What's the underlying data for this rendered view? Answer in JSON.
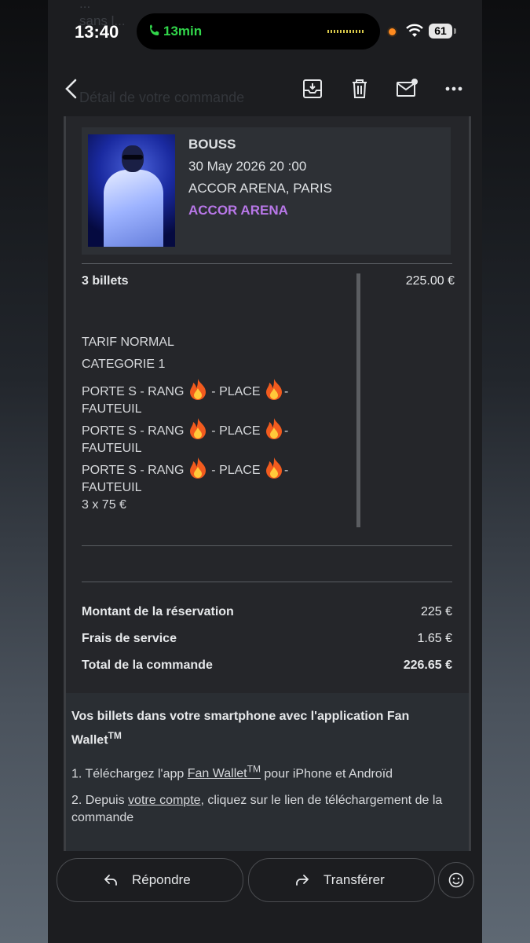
{
  "status_bar": {
    "time": "13:40",
    "call_duration": "13min",
    "battery": "61"
  },
  "background_ghost": {
    "line1": "...",
    "line2": "sans l...",
    "heading": "Détail de votre commande"
  },
  "event": {
    "artist": "BOUSS",
    "date": "30 May 2026 20 :00",
    "venue": "ACCOR ARENA, PARIS",
    "venue_link": "ACCOR ARENA"
  },
  "tickets": {
    "count_label": "3 billets",
    "price": "225.00 €",
    "tariff": "TARIF NORMAL",
    "category": "CATEGORIE 1",
    "seats": [
      {
        "a": "PORTE S - RANG ",
        "b": " - PLACE ",
        "c": "- FAUTEUIL"
      },
      {
        "a": "PORTE S - RANG ",
        "b": " - PLACE ",
        "c": "- FAUTEUIL"
      },
      {
        "a": "PORTE S - RANG ",
        "b": " - PLACE ",
        "c": "- FAUTEUIL"
      }
    ],
    "unit_price": "3 x 75 €"
  },
  "summary": {
    "reservation_label": "Montant de la réservation",
    "reservation_value": "225 €",
    "fees_label": "Frais de service",
    "fees_value": "1.65 €",
    "total_label": "Total de la commande",
    "total_value": "226.65 €"
  },
  "wallet": {
    "title": "Vos billets dans votre smartphone avec l'application Fan Wallet",
    "tm": "TM",
    "step1_prefix": "1. Téléchargez l'app ",
    "step1_link": "Fan Wallet",
    "step1_suffix": " pour iPhone et Androïd",
    "step2_prefix": "2. Depuis ",
    "step2_link": "votre compte",
    "step2_suffix": ", cliquez sur le lien de téléchargement de la commande"
  },
  "actions": {
    "reply": "Répondre",
    "forward": "Transférer"
  },
  "icons": [
    "back-icon",
    "archive-icon",
    "trash-icon",
    "mark-unread-icon",
    "more-icon",
    "reply-icon",
    "forward-icon",
    "emoji-icon",
    "fire-emoji"
  ],
  "colors": {
    "venue_link": "#b877e8",
    "call_green": "#32d74b"
  }
}
